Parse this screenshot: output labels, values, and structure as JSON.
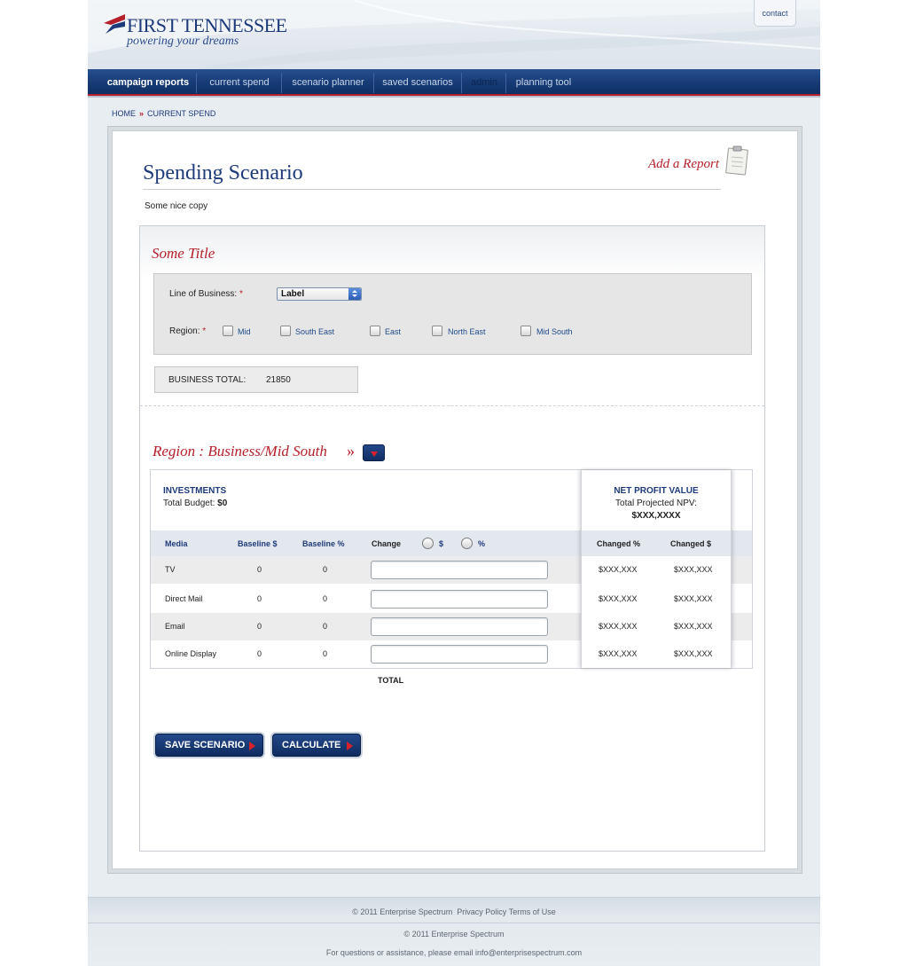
{
  "brand": {
    "name": "FIRST TENNESSEE",
    "tagline": "powering your dreams",
    "colors": {
      "navy": "#1d3a7a",
      "red": "#b6202b",
      "nav": "#163a74"
    }
  },
  "header": {
    "contact_label": "contact"
  },
  "nav": {
    "items": [
      {
        "label": "campaign reports",
        "active": true
      },
      {
        "label": "current spend"
      },
      {
        "label": "scenario planner"
      },
      {
        "label": "saved scenarios"
      },
      {
        "label": "admin"
      },
      {
        "label": "planning tool"
      }
    ]
  },
  "breadcrumb": {
    "home": "HOME",
    "separator": "»",
    "current": "CURRENT SPEND"
  },
  "page": {
    "title": "Spending Scenario",
    "add_report": "Add a Report",
    "intro": "Some nice copy"
  },
  "filters": {
    "section_title": "Some Title",
    "line_of_business_label": "Line of Business:",
    "required_mark": "*",
    "line_of_business_value": "Label",
    "region_label": "Region:",
    "regions": [
      "Mid",
      "South East",
      "East",
      "North East",
      "Mid South"
    ],
    "business_total_label": "BUSINESS TOTAL:",
    "business_total_value": "21850"
  },
  "region_section": {
    "title": "Region : Business/Mid South",
    "raquo": "»"
  },
  "investments": {
    "heading": "INVESTMENTS",
    "budget_label": "Total Budget:",
    "budget_value": "$0"
  },
  "npv": {
    "heading": "NET PROFIT VALUE",
    "label": "Total Projected NPV:",
    "value": "$XXX,XXXX"
  },
  "table": {
    "columns": {
      "media": "Media",
      "baseline_dollar": "Baseline $",
      "baseline_pct": "Baseline %",
      "change": "Change",
      "opt_dollar": "$",
      "opt_pct": "%",
      "changed_pct": "Changed %",
      "changed_dollar": "Changed $"
    },
    "rows": [
      {
        "media": "TV",
        "baseline_dollar": "0",
        "baseline_pct": "0",
        "change": "",
        "changed_pct": "$XXX,XXX",
        "changed_dollar": "$XXX,XXX"
      },
      {
        "media": "Direct Mail",
        "baseline_dollar": "0",
        "baseline_pct": "0",
        "change": "",
        "changed_pct": "$XXX,XXX",
        "changed_dollar": "$XXX,XXX"
      },
      {
        "media": "Email",
        "baseline_dollar": "0",
        "baseline_pct": "0",
        "change": "",
        "changed_pct": "$XXX,XXX",
        "changed_dollar": "$XXX,XXX"
      },
      {
        "media": "Online Display",
        "baseline_dollar": "0",
        "baseline_pct": "0",
        "change": "",
        "changed_pct": "$XXX,XXX",
        "changed_dollar": "$XXX,XXX"
      }
    ],
    "total_label": "TOTAL"
  },
  "buttons": {
    "save": "SAVE SCENARIO",
    "calculate": "CALCULATE"
  },
  "footer": {
    "copyright_main": "© 2011 Enterprise Spectrum",
    "privacy": "Privacy Policy",
    "terms": "Terms of Use",
    "copyright_secondary": "© 2011 Enterprise Spectrum",
    "assistance": "For questions or assistance, please email info@enterprisespectrum.com"
  }
}
